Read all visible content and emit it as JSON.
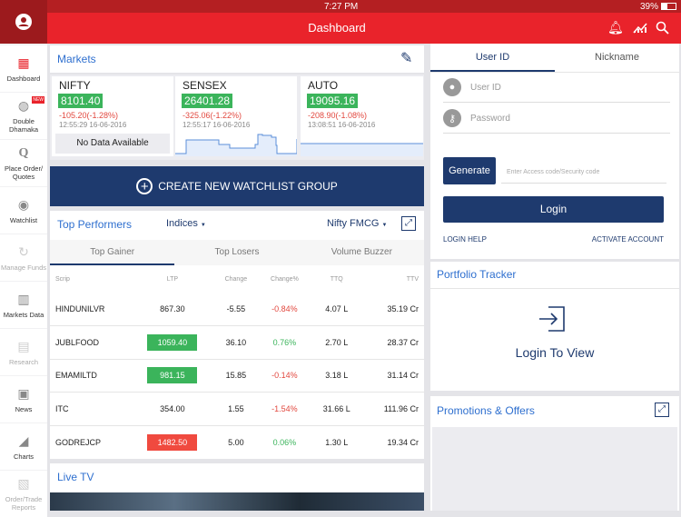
{
  "status": {
    "device": "iPad",
    "time": "7:27 PM",
    "battery": "39%"
  },
  "header": {
    "title": "Dashboard"
  },
  "sidebar": {
    "items": [
      {
        "label": "Dashboard",
        "icon": "grid-icon"
      },
      {
        "label": "Double Dhamaka",
        "icon": "globe-icon",
        "badge": "NEW"
      },
      {
        "label": "Place Order/ Quotes",
        "icon": "q-icon"
      },
      {
        "label": "Watchlist",
        "icon": "eye-icon"
      },
      {
        "label": "Manage Funds",
        "icon": "funds-icon"
      },
      {
        "label": "Markets Data",
        "icon": "bar-chart-icon"
      },
      {
        "label": "Research",
        "icon": "research-icon"
      },
      {
        "label": "News",
        "icon": "news-icon"
      },
      {
        "label": "Charts",
        "icon": "area-chart-icon"
      },
      {
        "label": "Order/Trade Reports",
        "icon": "report-icon"
      }
    ]
  },
  "markets": {
    "title": "Markets",
    "tiles": [
      {
        "name": "NIFTY",
        "price": "8101.40",
        "change": "-105.20(-1.28%)",
        "time": "12:55:29  16-06-2016",
        "nodata": "No Data Available"
      },
      {
        "name": "SENSEX",
        "price": "26401.28",
        "change": "-325.06(-1.22%)",
        "time": "12:55:17  16-06-2016"
      },
      {
        "name": "AUTO",
        "price": "19095.16",
        "change": "-208.90(-1.08%)",
        "time": "13:08:51  16-06-2016"
      }
    ]
  },
  "watchlist_button": "CREATE NEW WATCHLIST GROUP",
  "top_performers": {
    "title": "Top Performers",
    "indices": "Indices",
    "index": "Nifty FMCG",
    "tabs": [
      "Top Gainer",
      "Top Losers",
      "Volume Buzzer"
    ],
    "columns": [
      "Scrip",
      "LTP",
      "Change",
      "Change%",
      "TTQ",
      "TTV"
    ],
    "rows": [
      {
        "scrip": "HINDUNILVR",
        "ltp": "867.30",
        "change": "-5.55",
        "pct": "-0.84%",
        "ttq": "4.07 L",
        "ttv": "35.19 Cr",
        "hl": "",
        "dir": "neg"
      },
      {
        "scrip": "JUBLFOOD",
        "ltp": "1059.40",
        "change": "36.10",
        "pct": "0.76%",
        "ttq": "2.70 L",
        "ttv": "28.37 Cr",
        "hl": "g",
        "dir": "pos"
      },
      {
        "scrip": "EMAMILTD",
        "ltp": "981.15",
        "change": "15.85",
        "pct": "-0.14%",
        "ttq": "3.18 L",
        "ttv": "31.14 Cr",
        "hl": "g",
        "dir": "neg"
      },
      {
        "scrip": "ITC",
        "ltp": "354.00",
        "change": "1.55",
        "pct": "-1.54%",
        "ttq": "31.66 L",
        "ttv": "111.96 Cr",
        "hl": "",
        "dir": "neg"
      },
      {
        "scrip": "GODREJCP",
        "ltp": "1482.50",
        "change": "5.00",
        "pct": "0.06%",
        "ttq": "1.30 L",
        "ttv": "19.34 Cr",
        "hl": "r",
        "dir": "pos"
      }
    ]
  },
  "live_tv": {
    "title": "Live TV"
  },
  "login": {
    "tabs": [
      "User ID",
      "Nickname"
    ],
    "user_placeholder": "User ID",
    "password_placeholder": "Password",
    "generate": "Generate",
    "code_placeholder": "Enter Access code/Security code",
    "login": "Login",
    "help": "LOGIN HELP",
    "activate": "ACTIVATE ACCOUNT"
  },
  "portfolio": {
    "title": "Portfolio Tracker",
    "cta": "Login To View"
  },
  "promotions": {
    "title": "Promotions & Offers"
  }
}
